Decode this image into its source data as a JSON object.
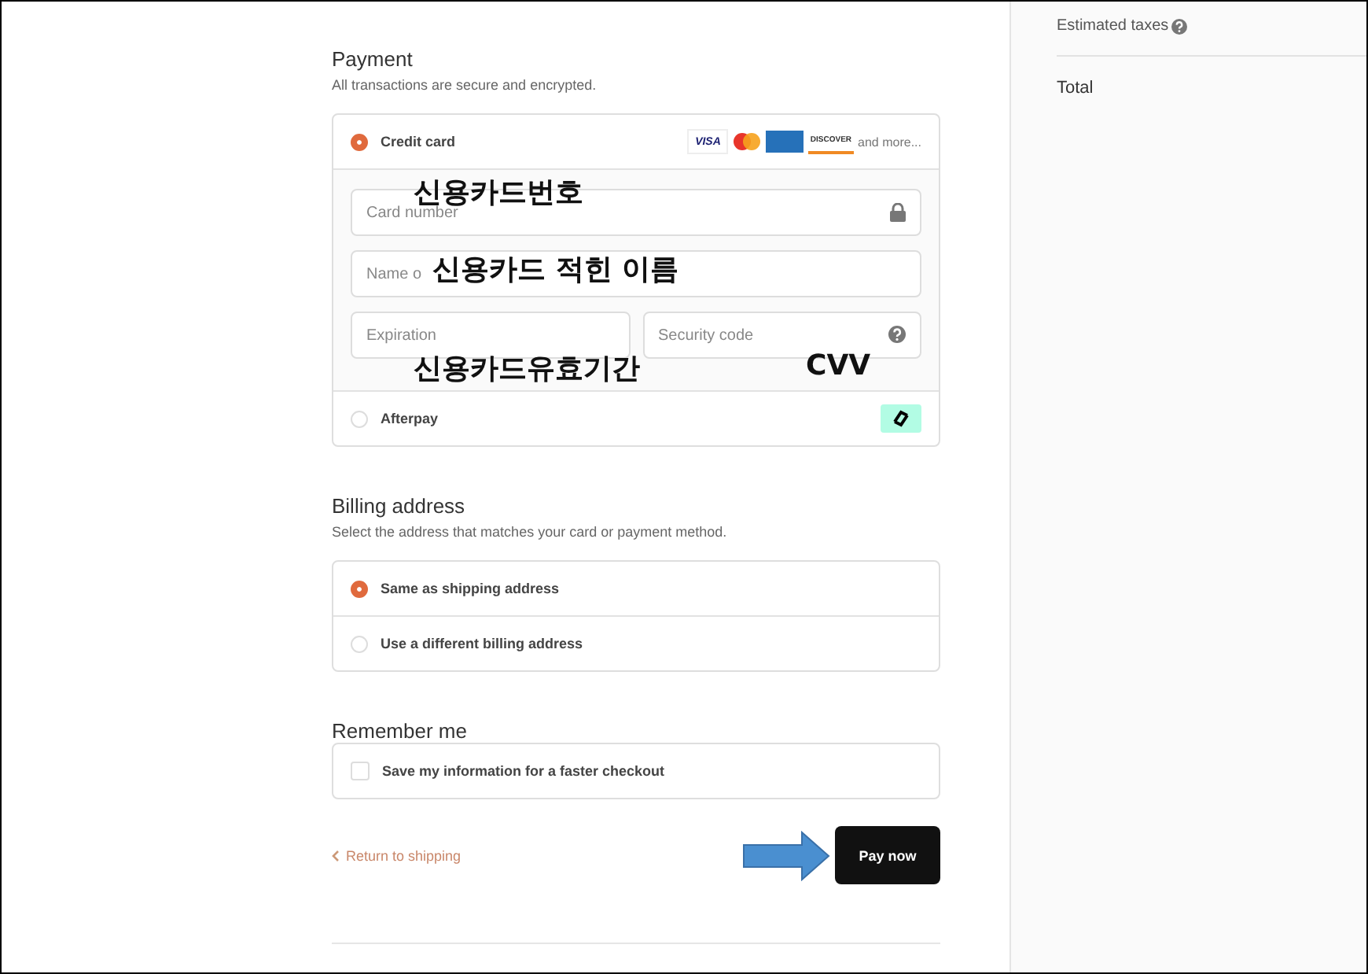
{
  "summary": {
    "rows": [
      {
        "label": "Estimated taxes",
        "help": true
      }
    ],
    "total_label": "Total"
  },
  "payment": {
    "title": "Payment",
    "subtitle": "All transactions are secure and encrypted.",
    "methods": [
      {
        "kind": "card",
        "label": "Credit card",
        "selected": true
      },
      {
        "kind": "afterpay",
        "label": "Afterpay",
        "selected": false
      }
    ],
    "card_brands": [
      {
        "kind": "visa",
        "label": "VISA"
      },
      {
        "kind": "mastercard"
      },
      {
        "kind": "amex"
      },
      {
        "kind": "discover",
        "label": "DISCOVER"
      }
    ],
    "more_text": "and more...",
    "fields": [
      {
        "kind": "card_number",
        "placeholder": "Card number",
        "annotation": "신용카드번호"
      },
      {
        "kind": "name",
        "placeholder": "Name o",
        "annotation": "신용카드 적힌 이름"
      },
      {
        "kind": "expiry",
        "placeholder": "Expiration",
        "annotation": "신용카드유효기간"
      },
      {
        "kind": "security",
        "placeholder": "Security code",
        "annotation": "CVV"
      }
    ]
  },
  "billing": {
    "title": "Billing address",
    "subtitle": "Select the address that matches your card or payment method.",
    "options": [
      {
        "label": "Same as shipping address",
        "selected": true
      },
      {
        "label": "Use a different billing address",
        "selected": false
      }
    ]
  },
  "remember": {
    "title": "Remember me",
    "options": [
      {
        "label": "Save my information for a faster checkout",
        "checked": false
      }
    ]
  },
  "footer": {
    "back_link": "Return to shipping",
    "pay_button": "Pay now",
    "pointer_arrow": true
  }
}
